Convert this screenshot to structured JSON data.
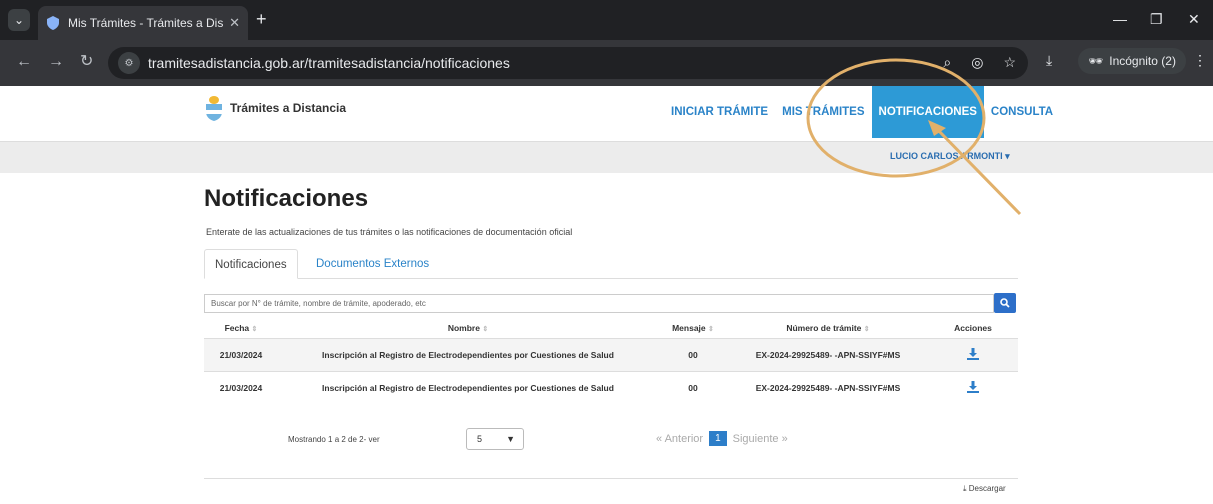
{
  "browser": {
    "tab_title": "Mis Trámites - Trámites a Distan",
    "url": "tramitesadistancia.gob.ar/tramitesadistancia/notificaciones",
    "incognito_label": "Incógnito (2)"
  },
  "header": {
    "brand": "Trámites a Distancia",
    "nav": [
      "INICIAR TRÁMITE",
      "MIS TRÁMITES",
      "NOTIFICACIONES",
      "CONSULTA"
    ],
    "user": "LUCIO CARLOS ARMONTI ▾"
  },
  "main": {
    "title": "Notificaciones",
    "subtitle": "Enterate de las actualizaciones de tus trámites o las notificaciones de documentación oficial",
    "tabs": [
      "Notificaciones",
      "Documentos Externos"
    ],
    "search_placeholder": "Buscar por N° de trámite, nombre de trámite, apoderado, etc",
    "columns": [
      "Fecha",
      "Nombre",
      "Mensaje",
      "Número de trámite",
      "Acciones"
    ],
    "rows": [
      {
        "fecha": "21/03/2024",
        "nombre": "Inscripción al Registro de Electrodependientes por Cuestiones de Salud",
        "mensaje": "00",
        "numero": "EX-2024-29925489- -APN-SSIYF#MS"
      },
      {
        "fecha": "21/03/2024",
        "nombre": "Inscripción al Registro de Electrodependientes por Cuestiones de Salud",
        "mensaje": "00",
        "numero": "EX-2024-29925489- -APN-SSIYF#MS"
      }
    ],
    "showing": "Mostrando 1 a 2 de 2- ver",
    "page_size": "5",
    "pager": {
      "prev": "« Anterior",
      "current": "1",
      "next": "Siguiente »"
    },
    "download": "Descargar"
  },
  "colors": {
    "accent": "#2d9ad6",
    "link": "#2a83c8",
    "annotation": "#e1b06a"
  }
}
